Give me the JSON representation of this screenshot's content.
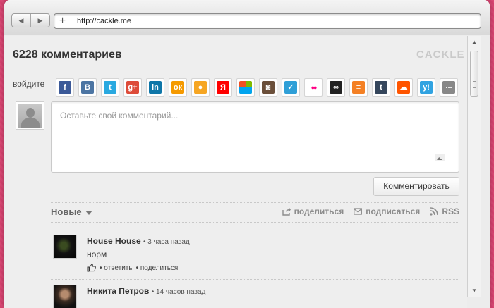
{
  "browser": {
    "back_label": "◀",
    "forward_label": "▶",
    "new_tab_label": "+",
    "url": "http://cackle.me"
  },
  "widget": {
    "comments_count": "6228 комментариев",
    "logo": "CACKLE",
    "login_label": "войдите",
    "textarea_placeholder": "Оставьте свой комментарий...",
    "submit_label": "Комментировать",
    "sort_label": "Новые",
    "share_label": "поделиться",
    "subscribe_label": "подписаться",
    "rss_label": "RSS"
  },
  "socials": [
    {
      "name": "facebook",
      "glyph": "f",
      "color": "#3b5998"
    },
    {
      "name": "vkontakte",
      "glyph": "B",
      "color": "#4c75a3"
    },
    {
      "name": "twitter",
      "glyph": "t",
      "color": "#2aa9e0"
    },
    {
      "name": "google-plus",
      "glyph": "g+",
      "color": "#dd4b39"
    },
    {
      "name": "linkedin",
      "glyph": "in",
      "color": "#0e76a8"
    },
    {
      "name": "odnoklassniki",
      "glyph": "ок",
      "color": "#f59a00"
    },
    {
      "name": "mail-ru",
      "glyph": "●",
      "color": "#f6a623"
    },
    {
      "name": "yandex",
      "glyph": "Я",
      "color": "#ff0000"
    },
    {
      "name": "microsoft",
      "glyph": "",
      "color": "#f25022"
    },
    {
      "name": "instagram",
      "glyph": "◙",
      "color": "#6b4f3a"
    },
    {
      "name": "livejournal",
      "glyph": "✓",
      "color": "#2f9fd7"
    },
    {
      "name": "flickr",
      "glyph": "●●",
      "color": "#ffffff"
    },
    {
      "name": "lastfm",
      "glyph": "∞",
      "color": "#222222"
    },
    {
      "name": "stackoverflow",
      "glyph": "≡",
      "color": "#f48024"
    },
    {
      "name": "tumblr",
      "glyph": "t",
      "color": "#35465c"
    },
    {
      "name": "soundcloud",
      "glyph": "☁",
      "color": "#ff5500"
    },
    {
      "name": "yahoo",
      "glyph": "y!",
      "color": "#31a3e1"
    },
    {
      "name": "more",
      "glyph": "...",
      "color": "#888888"
    }
  ],
  "comments": [
    {
      "author": "House House",
      "time": "• 3 часа назад",
      "text": "норм",
      "reply": "• ответить",
      "share": "• поделиться"
    },
    {
      "author": "Никита Петров",
      "time": "• 14 часов назад",
      "text": "",
      "reply": "",
      "share": ""
    }
  ]
}
